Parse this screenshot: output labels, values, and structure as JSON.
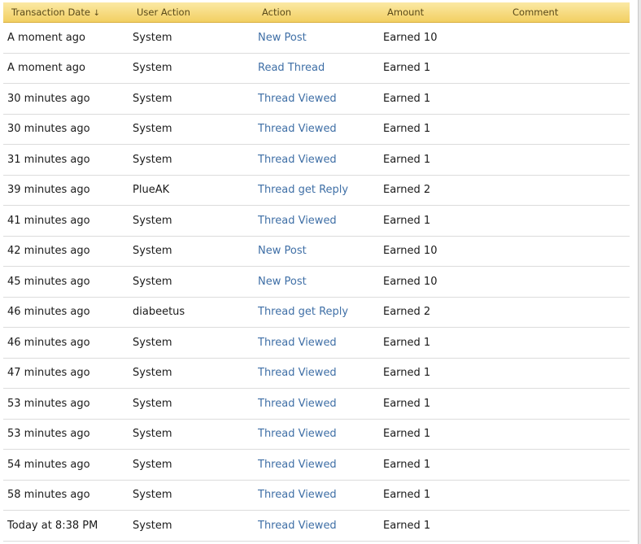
{
  "table": {
    "headers": {
      "transaction_date": "Transaction Date",
      "sort_indicator": "↓",
      "user_action": "User Action",
      "action": "Action",
      "amount": "Amount",
      "comment": "Comment"
    },
    "rows": [
      {
        "date": "A moment ago",
        "user": "System",
        "action": "New Post",
        "amount": "Earned 10",
        "comment": ""
      },
      {
        "date": "A moment ago",
        "user": "System",
        "action": "Read Thread",
        "amount": "Earned 1",
        "comment": ""
      },
      {
        "date": "30 minutes ago",
        "user": "System",
        "action": "Thread Viewed",
        "amount": "Earned 1",
        "comment": ""
      },
      {
        "date": "30 minutes ago",
        "user": "System",
        "action": "Thread Viewed",
        "amount": "Earned 1",
        "comment": ""
      },
      {
        "date": "31 minutes ago",
        "user": "System",
        "action": "Thread Viewed",
        "amount": "Earned 1",
        "comment": ""
      },
      {
        "date": "39 minutes ago",
        "user": "PlueAK",
        "action": "Thread get Reply",
        "amount": "Earned 2",
        "comment": ""
      },
      {
        "date": "41 minutes ago",
        "user": "System",
        "action": "Thread Viewed",
        "amount": "Earned 1",
        "comment": ""
      },
      {
        "date": "42 minutes ago",
        "user": "System",
        "action": "New Post",
        "amount": "Earned 10",
        "comment": ""
      },
      {
        "date": "45 minutes ago",
        "user": "System",
        "action": "New Post",
        "amount": "Earned 10",
        "comment": ""
      },
      {
        "date": "46 minutes ago",
        "user": "diabeetus",
        "action": "Thread get Reply",
        "amount": "Earned 2",
        "comment": ""
      },
      {
        "date": "46 minutes ago",
        "user": "System",
        "action": "Thread Viewed",
        "amount": "Earned 1",
        "comment": ""
      },
      {
        "date": "47 minutes ago",
        "user": "System",
        "action": "Thread Viewed",
        "amount": "Earned 1",
        "comment": ""
      },
      {
        "date": "53 minutes ago",
        "user": "System",
        "action": "Thread Viewed",
        "amount": "Earned 1",
        "comment": ""
      },
      {
        "date": "53 minutes ago",
        "user": "System",
        "action": "Thread Viewed",
        "amount": "Earned 1",
        "comment": ""
      },
      {
        "date": "54 minutes ago",
        "user": "System",
        "action": "Thread Viewed",
        "amount": "Earned 1",
        "comment": ""
      },
      {
        "date": "58 minutes ago",
        "user": "System",
        "action": "Thread Viewed",
        "amount": "Earned 1",
        "comment": ""
      },
      {
        "date": "Today at 8:38 PM",
        "user": "System",
        "action": "Thread Viewed",
        "amount": "Earned 1",
        "comment": ""
      }
    ]
  },
  "colors": {
    "header_gradient_top": "#fbe9a4",
    "header_gradient_bottom": "#f2cf62",
    "link": "#3f6fa6"
  }
}
